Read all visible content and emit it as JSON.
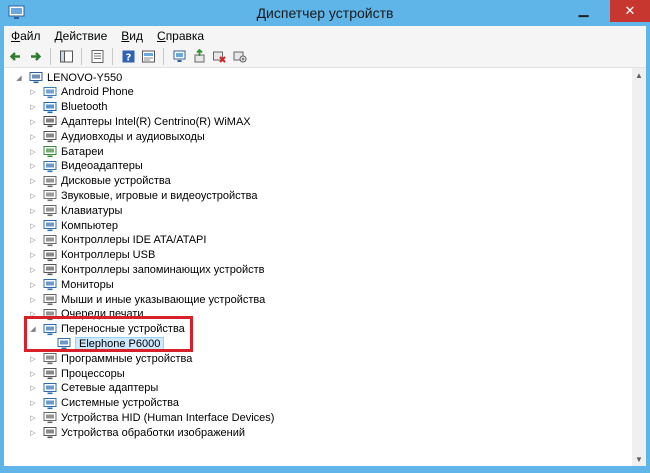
{
  "window": {
    "title": "Диспетчер устройств",
    "close_glyph": "✕",
    "min_glyph": "▁",
    "max_glyph": "▢"
  },
  "menu": [
    {
      "hot": "Ф",
      "rest": "айл"
    },
    {
      "hot": "Д",
      "rest": "ействие"
    },
    {
      "hot": "В",
      "rest": "ид"
    },
    {
      "hot": "С",
      "rest": "правка"
    }
  ],
  "toolbar": {
    "icons": [
      "back-icon",
      "forward-icon",
      "console-tree-icon",
      "properties-icon",
      "help-icon",
      "view-icon",
      "update-driver-icon",
      "disable-device-icon",
      "scan-hardware-icon"
    ]
  },
  "tree": {
    "root": {
      "label": "LENOVO-Y550",
      "icon": "computer-icon"
    },
    "items": [
      {
        "label": "Android Phone",
        "icon": "phone-icon",
        "color": "#3b7bbf"
      },
      {
        "label": "Bluetooth",
        "icon": "bluetooth-icon",
        "color": "#1565c0"
      },
      {
        "label": "Адаптеры Intel(R) Centrino(R) WiMAX",
        "icon": "wimax-icon",
        "color": "#4a4a4a"
      },
      {
        "label": "Аудиовходы и аудиовыходы",
        "icon": "audio-icon",
        "color": "#555555"
      },
      {
        "label": "Батареи",
        "icon": "battery-icon",
        "color": "#3a8a3a"
      },
      {
        "label": "Видеоадаптеры",
        "icon": "display-adapter-icon",
        "color": "#2e6db4"
      },
      {
        "label": "Дисковые устройства",
        "icon": "disk-icon",
        "color": "#6a6a6a"
      },
      {
        "label": "Звуковые, игровые и видеоустройства",
        "icon": "sound-icon",
        "color": "#707070"
      },
      {
        "label": "Клавиатуры",
        "icon": "keyboard-icon",
        "color": "#666666"
      },
      {
        "label": "Компьютер",
        "icon": "computer-icon",
        "color": "#2e6db4"
      },
      {
        "label": "Контроллеры IDE ATA/ATAPI",
        "icon": "ide-controller-icon",
        "color": "#6a6a6a"
      },
      {
        "label": "Контроллеры USB",
        "icon": "usb-icon",
        "color": "#555555"
      },
      {
        "label": "Контроллеры запоминающих устройств",
        "icon": "storage-controller-icon",
        "color": "#555555"
      },
      {
        "label": "Мониторы",
        "icon": "monitor-icon",
        "color": "#2e6db4"
      },
      {
        "label": "Мыши и иные указывающие устройства",
        "icon": "mouse-icon",
        "color": "#666666"
      },
      {
        "label": "Очереди печати",
        "icon": "printer-icon",
        "color": "#666666"
      },
      {
        "label": "Переносные устройства",
        "icon": "portable-device-icon",
        "color": "#2e6db4",
        "expanded": true
      },
      {
        "label": "Elephone P6000",
        "icon": "portable-device-icon",
        "color": "#2e6db4",
        "child": true,
        "selected": true
      },
      {
        "label": "Программные устройства",
        "icon": "software-device-icon",
        "color": "#666666"
      },
      {
        "label": "Процессоры",
        "icon": "processor-icon",
        "color": "#555555"
      },
      {
        "label": "Сетевые адаптеры",
        "icon": "network-adapter-icon",
        "color": "#2e6db4"
      },
      {
        "label": "Системные устройства",
        "icon": "system-device-icon",
        "color": "#2e6db4"
      },
      {
        "label": "Устройства HID (Human Interface Devices)",
        "icon": "hid-icon",
        "color": "#666666"
      },
      {
        "label": "Устройства обработки изображений",
        "icon": "imaging-device-icon",
        "color": "#555555"
      }
    ]
  },
  "colors": {
    "accent": "#5fb4e8",
    "highlight": "#d8202a",
    "selection": "#cde8ff"
  }
}
